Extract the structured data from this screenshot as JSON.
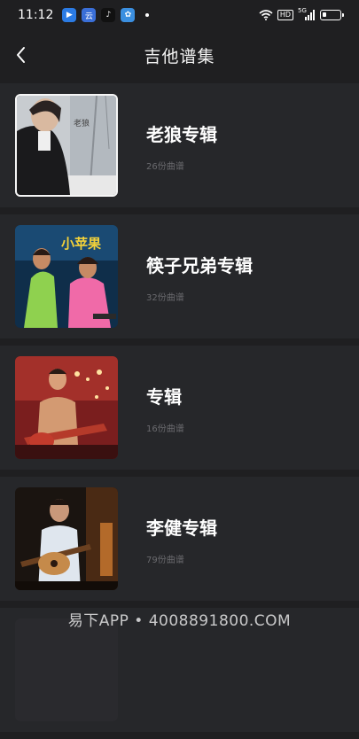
{
  "status": {
    "time": "11:12",
    "app_icons": [
      {
        "name": "video-app-icon",
        "glyph": "▶",
        "color": "#2b7be4"
      },
      {
        "name": "cloud-app-icon",
        "glyph": "云",
        "color": "#3a6fd8"
      },
      {
        "name": "tiktok-icon",
        "glyph": "♪",
        "color": "#111111"
      },
      {
        "name": "gallery-app-icon",
        "glyph": "✿",
        "color": "#3b8fe0"
      }
    ],
    "hd": "HD",
    "signal": "5G",
    "battery_level": 0.25
  },
  "header": {
    "back_icon": "chevron-left-icon",
    "title": "吉他谱集"
  },
  "albums": [
    {
      "title": "老狼专辑",
      "count": "26份曲谱",
      "thumb_text": "老狼",
      "selected": true
    },
    {
      "title": "筷子兄弟专辑",
      "count": "32份曲谱",
      "thumb_text": "小苹果",
      "selected": false
    },
    {
      "title": "专辑",
      "count": "16份曲谱",
      "thumb_text": "",
      "selected": false
    },
    {
      "title": "李健专辑",
      "count": "79份曲谱",
      "thumb_text": "",
      "selected": false
    }
  ],
  "watermark": "易下APP • 4008891800.COM"
}
